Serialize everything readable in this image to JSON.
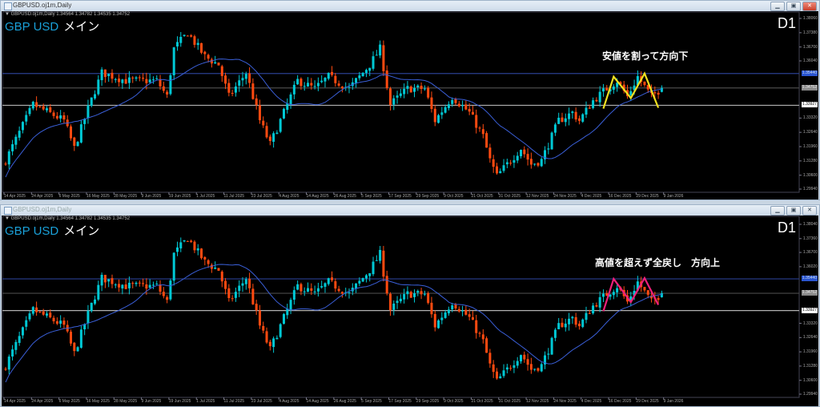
{
  "windows": [
    {
      "title": "GBPUSD.oj1m,Daily",
      "header": "▼ GBPUSD.oj1m,Daily  1.34564 1.34782 1.34535 1.34752",
      "symbol": "GBP USD",
      "symbol_sub": "メイン",
      "timeframe": "D1",
      "annotation": "安値を割って方向下",
      "zigzag_color": "#f0e020",
      "zigzag": [
        [
          174,
          1.3377
        ],
        [
          177,
          1.3529
        ],
        [
          182,
          1.3427
        ],
        [
          186,
          1.3544
        ],
        [
          190,
          1.3381
        ]
      ],
      "price_labels": [
        "1.38060",
        "1.37380",
        "1.36700",
        "1.36040",
        "1.33320",
        "1.32640",
        "1.31960",
        "1.31280",
        "1.30600",
        "1.29940"
      ],
      "price_range": [
        1.2994,
        1.3806
      ]
    },
    {
      "title": "GBPUSD.oj1m,Daily",
      "header": "▼ GBPUSD.oj1m,Daily  1.34564 1.34782 1.34535 1.34752",
      "symbol": "GBP USD",
      "symbol_sub": "メイン",
      "timeframe": "D1",
      "annotation": "高値を超えず全戻し　方向上",
      "zigzag_color": "#f0207a",
      "zigzag": [
        [
          174,
          1.339
        ],
        [
          177,
          1.3544
        ],
        [
          182,
          1.3433
        ],
        [
          186,
          1.3548
        ],
        [
          190,
          1.342
        ]
      ],
      "price_labels": [
        "1.38040",
        "1.37360",
        "1.36700",
        "1.36020",
        "1.33320",
        "1.32640",
        "1.31960",
        "1.31280",
        "1.30600",
        "1.29940"
      ],
      "price_range": [
        1.2994,
        1.3804
      ]
    }
  ],
  "levels": [
    {
      "price": 1.3544,
      "label": "1.35440",
      "color": "#2a3f90",
      "tag_bg": "#2a55d0",
      "tag_fg": "#cde"
    },
    {
      "price": 1.34752,
      "label": "1.34752",
      "color": "#4a4a4a",
      "tag_bg": "#8a8a8a",
      "tag_fg": "#eee"
    },
    {
      "price": 1.33927,
      "label": "1.33927",
      "color": "#b0b0b0",
      "tag_bg": "#ffffff",
      "tag_fg": "#000"
    }
  ],
  "dates": [
    "14 Apr 2025",
    "24 Apr 2025",
    "6 May 2025",
    "16 May 2025",
    "28 May 2025",
    "9 Jun 2025",
    "19 Jun 2025",
    "1 Jul 2025",
    "11 Jul 2025",
    "23 Jul 2025",
    "4 Aug 2025",
    "14 Aug 2025",
    "26 Aug 2025",
    "5 Sep 2025",
    "17 Sep 2025",
    "29 Sep 2025",
    "9 Oct 2025",
    "21 Oct 2025",
    "31 Oct 2025",
    "12 Nov 2025",
    "24 Nov 2025",
    "4 Dec 2025",
    "16 Dec 2025",
    "29 Dec 2025",
    "9 Jan 2026"
  ],
  "chart_data": {
    "type": "candlestick",
    "symbol": "GBPUSD",
    "timeframe": "D1",
    "ma_period": 20,
    "bull_color": "#00c8d4",
    "bear_color": "#ff4a10",
    "ma_color": "#3a5fd8",
    "last_ohlc": {
      "open": 1.34564,
      "high": 1.34782,
      "low": 1.34535,
      "close": 1.34752
    },
    "approx_close_keypoints": [
      [
        0,
        1.3131
      ],
      [
        8,
        1.3396
      ],
      [
        17,
        1.332
      ],
      [
        20,
        1.3188
      ],
      [
        24,
        1.3377
      ],
      [
        28,
        1.3548
      ],
      [
        35,
        1.351
      ],
      [
        44,
        1.351
      ],
      [
        47,
        1.3434
      ],
      [
        49,
        1.3662
      ],
      [
        53,
        1.3738
      ],
      [
        58,
        1.3624
      ],
      [
        62,
        1.3586
      ],
      [
        65,
        1.3434
      ],
      [
        70,
        1.3548
      ],
      [
        74,
        1.332
      ],
      [
        77,
        1.3207
      ],
      [
        81,
        1.3358
      ],
      [
        85,
        1.351
      ],
      [
        90,
        1.3472
      ],
      [
        94,
        1.3529
      ],
      [
        100,
        1.3472
      ],
      [
        106,
        1.3586
      ],
      [
        109,
        1.3662
      ],
      [
        112,
        1.3396
      ],
      [
        117,
        1.3472
      ],
      [
        122,
        1.3472
      ],
      [
        125,
        1.332
      ],
      [
        130,
        1.3434
      ],
      [
        135,
        1.3358
      ],
      [
        139,
        1.3245
      ],
      [
        141,
        1.3131
      ],
      [
        143,
        1.3055
      ],
      [
        147,
        1.3131
      ],
      [
        150,
        1.3188
      ],
      [
        153,
        1.3112
      ],
      [
        156,
        1.3131
      ],
      [
        161,
        1.332
      ],
      [
        165,
        1.3358
      ],
      [
        167,
        1.332
      ],
      [
        171,
        1.3415
      ],
      [
        175,
        1.3472
      ],
      [
        178,
        1.351
      ],
      [
        181,
        1.3434
      ],
      [
        184,
        1.3529
      ],
      [
        188,
        1.3434
      ],
      [
        191,
        1.34752
      ]
    ]
  }
}
